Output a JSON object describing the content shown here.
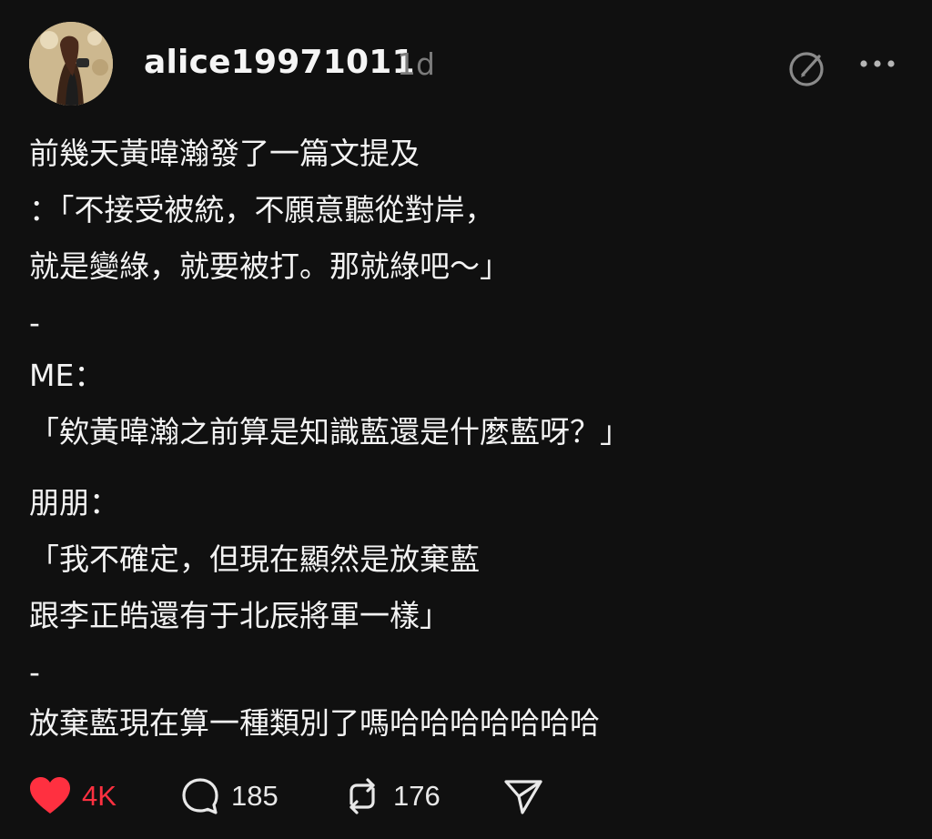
{
  "post": {
    "username": "alice19971011",
    "time": "1d",
    "lines": [
      "前幾天黃暐瀚發了一篇文提及",
      "：「不接受被統，不願意聽從對岸，",
      "就是變綠，就要被打。那就綠吧～」",
      "-",
      "ME：",
      "「欸黃暐瀚之前算是知識藍還是什麼藍呀？」",
      "朋朋：",
      "「我不確定，但現在顯然是放棄藍",
      "跟李正皓還有于北辰將軍一樣」",
      "-",
      "放棄藍現在算一種類別了嗎哈哈哈哈哈哈哈"
    ]
  },
  "actions": {
    "like_count": "4K",
    "comment_count": "185",
    "repost_count": "176"
  },
  "icons": {
    "like": "heart-icon",
    "comment": "comment-bubble-icon",
    "repost": "repost-icon",
    "share": "send-icon",
    "edit": "edit-icon",
    "more": "more-dots-icon"
  },
  "colors": {
    "background": "#101010",
    "text": "#f3f3f3",
    "muted": "#7b7b7b",
    "like": "#ff3040"
  }
}
